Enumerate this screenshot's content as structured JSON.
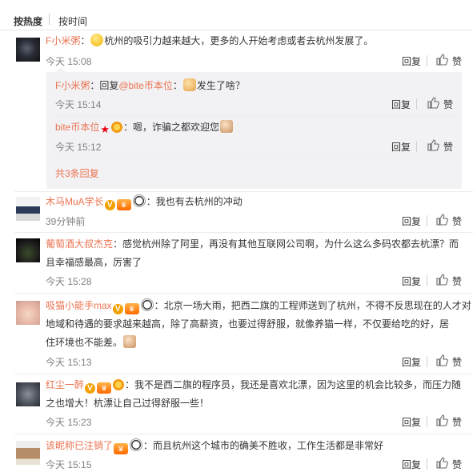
{
  "sort": {
    "hot": "按热度",
    "time": "按时间"
  },
  "actions": {
    "reply": "回复",
    "like": "赞"
  },
  "comments": [
    {
      "name": "F小米粥",
      "sep": "：",
      "text": "杭州的吸引力越来越大，更多的人开始考虑或者去杭州发展了。",
      "time": "今天 15:08",
      "replies": [
        {
          "name": "F小米粥",
          "text_prefix": "：回复",
          "mention": "@bite币本位",
          "sep": "：",
          "text": "发生了啥？",
          "time": "今天 15:14"
        },
        {
          "name": "bite币本位",
          "sep": "：",
          "text": "嗯，诈骗之都欢迎您",
          "time": "今天 15:12"
        }
      ],
      "more": "共3条回复"
    },
    {
      "name": "木马MuA学长",
      "sep": "：",
      "text": "我也有去杭州的冲动",
      "time": "39分钟前"
    },
    {
      "name": "葡萄酒大叔杰克",
      "sep": "：",
      "text_line1": "感觉杭州除了阿里，再没有其他互联网公司啊，为什么这么多码农都去杭漂？而",
      "text_line2": "且幸福感最高，厉害了",
      "time": "今天 15:28"
    },
    {
      "name": "吸猫小能手max",
      "sep": "：",
      "text_line1": "北京一场大雨，把西二旗的工程师送到了杭州，不得不反思现在的人才对",
      "text_line2": "地域和待遇的要求越来越高，除了高薪资，也要过得舒服，就像养猫一样，不仅要给吃的好，居",
      "text_line3": "住环境也不能差。",
      "time": "今天 15:13"
    },
    {
      "name": "红尘一醉",
      "sep": "：",
      "text_line1": "我不是西二旗的程序员，我还是喜欢北漂，因为这里的机会比较多，而压力随",
      "text_line2": "之也增大！杭漂让自己过得舒服一些！",
      "time": "今天 15:23"
    },
    {
      "name": "该昵称已注销了",
      "sep": "：",
      "text": "而且杭州这个城市的确美不胜收，工作生活都是非常好",
      "time": "今天 15:15"
    }
  ]
}
